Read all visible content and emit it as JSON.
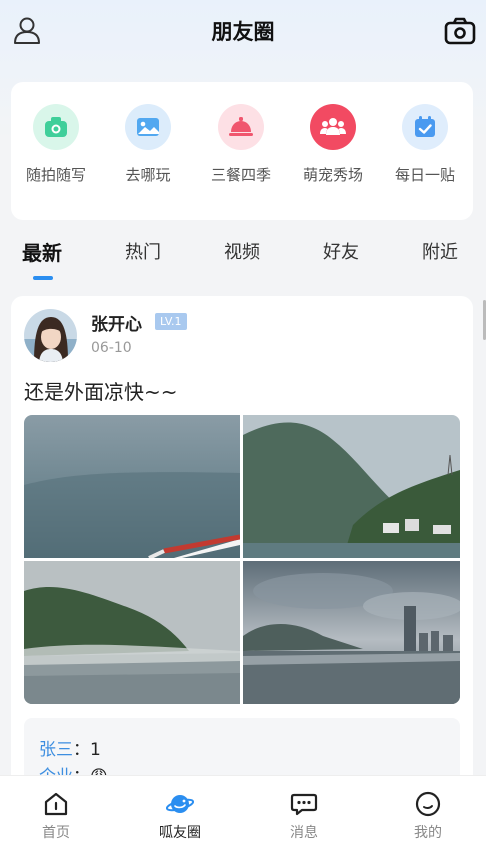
{
  "header": {
    "title": "朋友圈",
    "left_icon": "user-icon",
    "right_icon": "camera-icon"
  },
  "quick_actions": [
    {
      "label": "随拍随写",
      "icon": "camera-icon",
      "color": "#3fcf9a"
    },
    {
      "label": "去哪玩",
      "icon": "picture-icon",
      "color": "#52a8f0"
    },
    {
      "label": "三餐四季",
      "icon": "dish-icon",
      "color": "#f0566e"
    },
    {
      "label": "萌宠秀场",
      "icon": "group-icon",
      "color": "#f24a62"
    },
    {
      "label": "每日一贴",
      "icon": "calendar-icon",
      "color": "#4a9af0"
    }
  ],
  "tabs": [
    {
      "label": "最新",
      "active": true
    },
    {
      "label": "热门",
      "active": false
    },
    {
      "label": "视频",
      "active": false
    },
    {
      "label": "好友",
      "active": false
    },
    {
      "label": "附近",
      "active": false
    }
  ],
  "post": {
    "username": "张开心",
    "level": "LV.1",
    "date": "06-10",
    "text": "还是外面凉快~~",
    "photo_count": 4,
    "comments": [
      {
        "name": "张三",
        "sep": "：",
        "text": "1"
      },
      {
        "name": "企业",
        "sep": "：",
        "text": "😩"
      }
    ]
  },
  "bottom_nav": [
    {
      "label": "首页",
      "icon": "home-icon",
      "active": false
    },
    {
      "label": "呱友圈",
      "icon": "planet-icon",
      "active": true
    },
    {
      "label": "消息",
      "icon": "chat-icon",
      "active": false
    },
    {
      "label": "我的",
      "icon": "profile-icon",
      "active": false
    }
  ],
  "colors": {
    "accent": "#2b8ef0",
    "comment_name": "#3d8ee0",
    "level_badge": "#a9c9ef"
  }
}
